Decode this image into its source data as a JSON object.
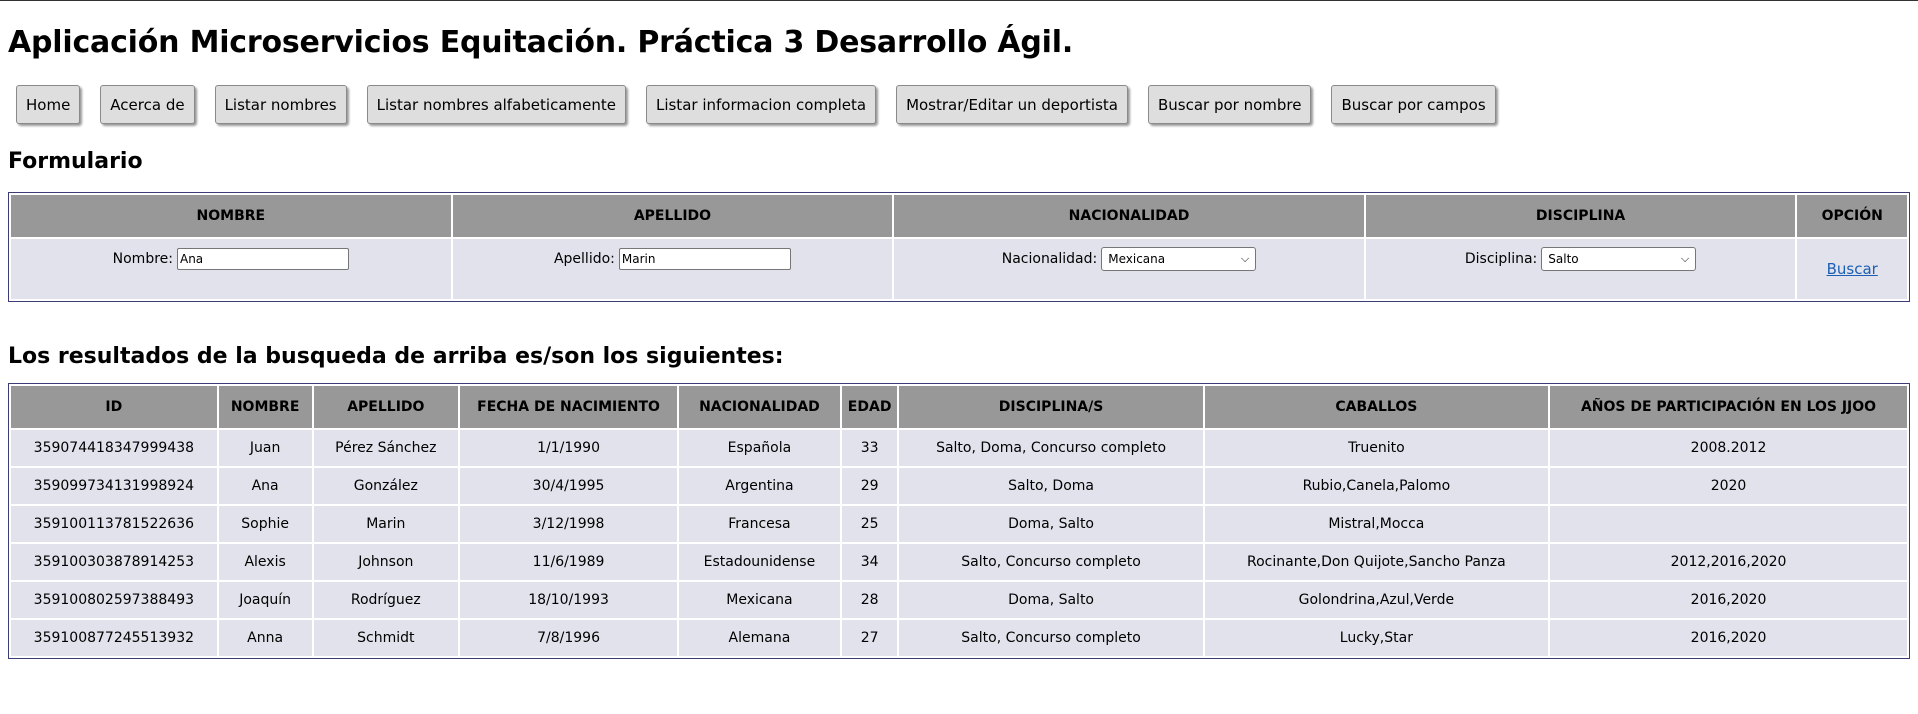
{
  "page": {
    "title": "Aplicación Microservicios Equitación. Práctica 3 Desarrollo Ágil."
  },
  "nav": [
    {
      "label": "Home"
    },
    {
      "label": "Acerca de"
    },
    {
      "label": "Listar nombres"
    },
    {
      "label": "Listar nombres alfabeticamente"
    },
    {
      "label": "Listar informacion completa"
    },
    {
      "label": "Mostrar/Editar un deportista"
    },
    {
      "label": "Buscar por nombre"
    },
    {
      "label": "Buscar por campos"
    }
  ],
  "form": {
    "title": "Formulario",
    "headers": [
      "NOMBRE",
      "APELLIDO",
      "NACIONALIDAD",
      "DISCIPLINA",
      "OPCIÓN"
    ],
    "nombre_label": "Nombre:",
    "nombre_value": "Ana",
    "apellido_label": "Apellido:",
    "apellido_value": "Marin",
    "nacionalidad_label": "Nacionalidad:",
    "nacionalidad_value": "Mexicana",
    "disciplina_label": "Disciplina:",
    "disciplina_value": "Salto",
    "buscar_label": "Buscar"
  },
  "results": {
    "title": "Los resultados de la busqueda de arriba es/son los siguientes:",
    "headers": [
      "ID",
      "NOMBRE",
      "APELLIDO",
      "FECHA DE NACIMIENTO",
      "NACIONALIDAD",
      "EDAD",
      "DISCIPLINA/S",
      "CABALLOS",
      "AÑOS DE PARTICIPACIÓN EN LOS JJOO"
    ],
    "rows": [
      [
        "359074418347999438",
        "Juan",
        "Pérez Sánchez",
        "1/1/1990",
        "Española",
        "33",
        "Salto, Doma, Concurso completo",
        "Truenito",
        "2008.2012"
      ],
      [
        "359099734131998924",
        "Ana",
        "González",
        "30/4/1995",
        "Argentina",
        "29",
        "Salto, Doma",
        "Rubio,Canela,Palomo",
        "2020"
      ],
      [
        "359100113781522636",
        "Sophie",
        "Marin",
        "3/12/1998",
        "Francesa",
        "25",
        "Doma, Salto",
        "Mistral,Mocca",
        ""
      ],
      [
        "359100303878914253",
        "Alexis",
        "Johnson",
        "11/6/1989",
        "Estadounidense",
        "34",
        "Salto, Concurso completo",
        "Rocinante,Don Quijote,Sancho Panza",
        "2012,2016,2020"
      ],
      [
        "359100802597388493",
        "Joaquín",
        "Rodríguez",
        "18/10/1993",
        "Mexicana",
        "28",
        "Doma, Salto",
        "Golondrina,Azul,Verde",
        "2016,2020"
      ],
      [
        "359100877245513932",
        "Anna",
        "Schmidt",
        "7/8/1996",
        "Alemana",
        "27",
        "Salto, Concurso completo",
        "Lucky,Star",
        "2016,2020"
      ]
    ]
  }
}
